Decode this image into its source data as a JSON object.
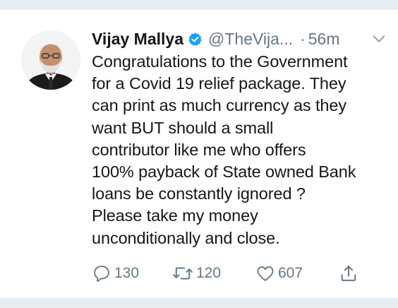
{
  "tweet": {
    "author": {
      "display_name": "Vijay Mallya",
      "handle": "@TheVija...",
      "verified": true
    },
    "separator": "·",
    "timestamp": "56m",
    "text_lines": [
      "Congratulations to the Government",
      "for a Covid 19 relief package. They",
      "can print as much currency as they",
      "want BUT should a small",
      "contributor like me who offers",
      "100% payback of State owned Bank",
      "loans be constantly ignored ?",
      "Please take my money",
      "unconditionally and close."
    ],
    "actions": {
      "reply_count": "130",
      "retweet_count": "120",
      "like_count": "607"
    },
    "icons": {
      "verified": "verified-badge-icon",
      "menu": "chevron-down-icon",
      "reply": "reply-icon",
      "retweet": "retweet-icon",
      "like": "heart-icon",
      "share": "share-icon"
    }
  },
  "colors": {
    "text_primary": "#14171a",
    "text_secondary": "#657786",
    "verified_blue": "#1da1f2",
    "divider": "#e6ecf0",
    "background": "#ffffff"
  }
}
